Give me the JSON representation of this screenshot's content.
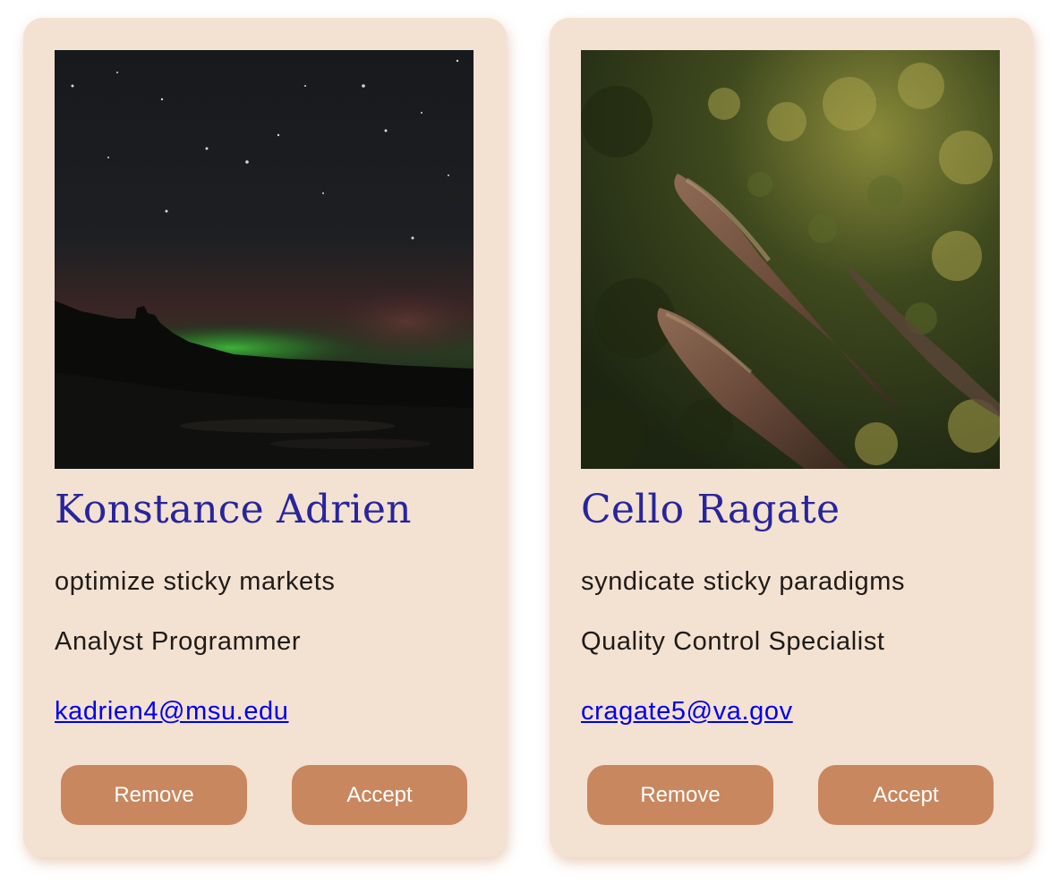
{
  "cards": [
    {
      "photo": "aurora-night-sky-photo",
      "name": "Konstance Adrien",
      "tagline": "optimize sticky markets",
      "role": "Analyst Programmer",
      "email": "kadrien4@msu.edu",
      "remove_label": "Remove",
      "accept_label": "Accept"
    },
    {
      "photo": "aerial-forest-rocks-photo",
      "name": "Cello Ragate",
      "tagline": "syndicate sticky paradigms",
      "role": "Quality Control Specialist",
      "email": "cragate5@va.gov",
      "remove_label": "Remove",
      "accept_label": "Accept"
    }
  ],
  "colors": {
    "card_bg": "#f3e1d2",
    "name": "#27259c",
    "button": "#c9875f",
    "link": "#0000ee"
  }
}
